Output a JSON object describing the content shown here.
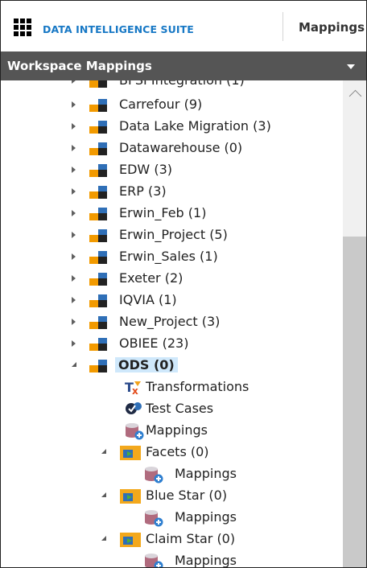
{
  "header": {
    "brand": "DATA INTELLIGENCE SUITE",
    "nav_item": "Mappings"
  },
  "panel": {
    "title": "Workspace Mappings"
  },
  "tree": {
    "partial_top": "BFSI Integration (1)",
    "projects": [
      "Carrefour (9)",
      "Data Lake Migration (3)",
      "Datawarehouse (0)",
      "EDW (3)",
      "ERP (3)",
      "Erwin_Feb (1)",
      "Erwin_Project (5)",
      "Erwin_Sales (1)",
      "Exeter (2)",
      "IQVIA (1)",
      "New_Project (3)",
      "OBIEE (23)"
    ],
    "selected": "ODS (0)",
    "ods_children": {
      "transformations": "Transformations",
      "test_cases": "Test Cases",
      "mappings": "Mappings"
    },
    "subjects": [
      {
        "name": "Facets (0)",
        "child": "Mappings"
      },
      {
        "name": "Blue Star (0)",
        "child": "Mappings"
      },
      {
        "name": "Claim Star (0)",
        "child": "Mappings"
      }
    ]
  }
}
